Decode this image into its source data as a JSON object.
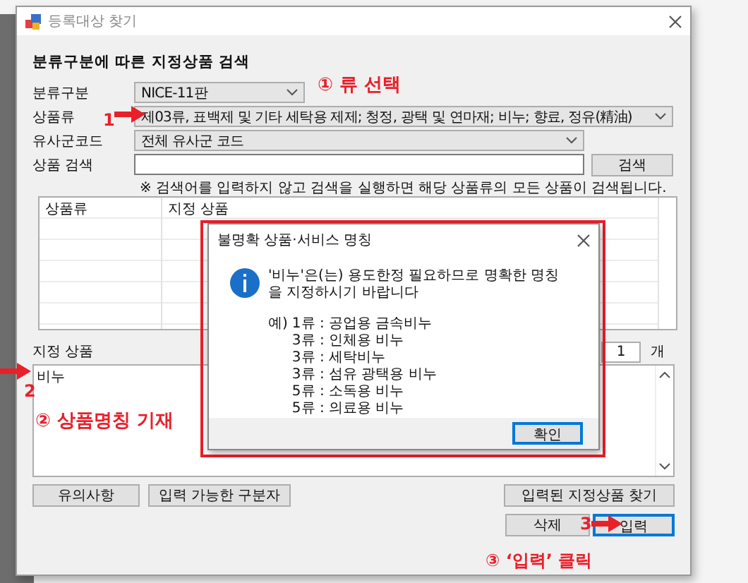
{
  "window": {
    "title": "등록대상 찾기"
  },
  "heading": "분류구분에 따른 지정상품 검색",
  "fields": [
    {
      "label": "분류구분",
      "kind": "combo",
      "value": "NICE-11판"
    },
    {
      "label": "상품류",
      "kind": "combo",
      "value": "제03류, 표백제 및 기타 세탁용 제제; 청정, 광택 및 연마재; 비누; 향료, 정유(精油)"
    },
    {
      "label": "유사군코드",
      "kind": "combo",
      "value": "전체 유사군 코드"
    },
    {
      "label": "상품 검색",
      "kind": "text"
    }
  ],
  "search_button": "검색",
  "note": "※ 검색어를 입력하지 않고 검색을 실행하면 해당 상품류의 모든 상품이 검색됩니다.",
  "table": {
    "columns": [
      "상품류",
      "지정 상품"
    ]
  },
  "designated": {
    "label": "지정 상품",
    "count": "1",
    "unit": "개",
    "text": "비누"
  },
  "buttons": [
    {
      "label": "유의사항",
      "focused": false
    },
    {
      "label": "입력 가능한 구분자",
      "focused": false
    },
    {
      "label": "입력된 지정상품 찾기",
      "focused": false
    },
    {
      "label": "삭제",
      "focused": false
    },
    {
      "label": "입력",
      "focused": true
    }
  ],
  "dialog": {
    "title": "불명확 상품·서비스 명칭",
    "message": "'비누'은(는) 용도한정 필요하므로 명확한 명칭을 지정하시기 바랍니다",
    "examples_prefix": "예)",
    "examples": [
      "1류 : 공업용 금속비누",
      "3류 : 인체용 비누",
      "3류 : 세탁비누",
      "3류 : 섬유 광택용 비누",
      "5류 : 소독용 비누",
      "5류 : 의료용 비누"
    ],
    "button": "확인"
  },
  "steps": [
    "① 류 선택",
    "② 상품명칭 기재",
    "③ ‘입력’ 클릭"
  ],
  "arrows": [
    "1",
    "2",
    "3"
  ]
}
